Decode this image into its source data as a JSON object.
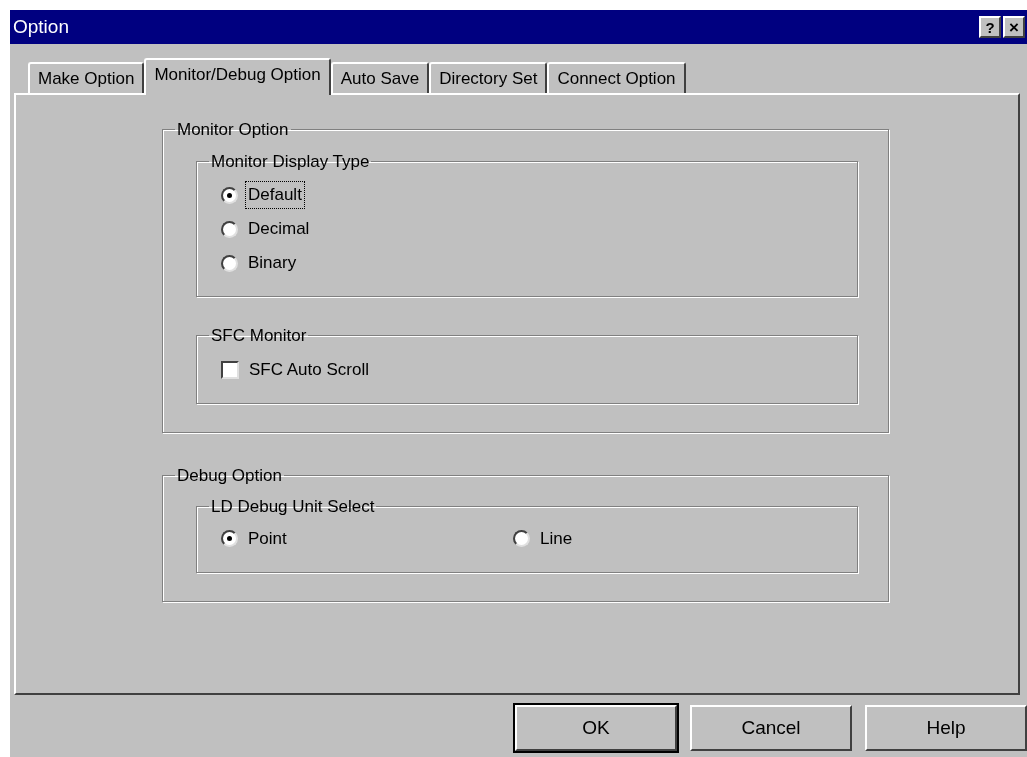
{
  "window": {
    "title": "Option",
    "help_button": "?",
    "close_button": "×"
  },
  "tabs": [
    {
      "label": "Make Option",
      "selected": false
    },
    {
      "label": "Monitor/Debug Option",
      "selected": true
    },
    {
      "label": "Auto Save",
      "selected": false
    },
    {
      "label": "Directory Set",
      "selected": false
    },
    {
      "label": "Connect Option",
      "selected": false
    }
  ],
  "sections": [
    {
      "title": "Monitor Option",
      "groups": [
        {
          "title": "Monitor Display Type",
          "kind": "column",
          "items": [
            {
              "kind": "radio",
              "label": "Default",
              "selected": true,
              "focused": true
            },
            {
              "kind": "radio",
              "label": "Decimal",
              "selected": false,
              "focused": false
            },
            {
              "kind": "radio",
              "label": "Binary",
              "selected": false,
              "focused": false
            }
          ]
        },
        {
          "title": "SFC Monitor",
          "kind": "column",
          "items": [
            {
              "kind": "checkbox",
              "label": "SFC Auto Scroll",
              "checked": false,
              "focused": false
            }
          ]
        }
      ]
    },
    {
      "title": "Debug Option",
      "groups": [
        {
          "title": "LD Debug Unit Select",
          "kind": "row",
          "items": [
            {
              "kind": "radio",
              "label": "Point",
              "selected": true,
              "focused": false
            },
            {
              "kind": "radio",
              "label": "Line",
              "selected": false,
              "focused": false
            }
          ]
        }
      ]
    }
  ],
  "buttons": [
    {
      "label": "OK",
      "default": true
    },
    {
      "label": "Cancel",
      "default": false
    },
    {
      "label": "Help",
      "default": false
    }
  ]
}
